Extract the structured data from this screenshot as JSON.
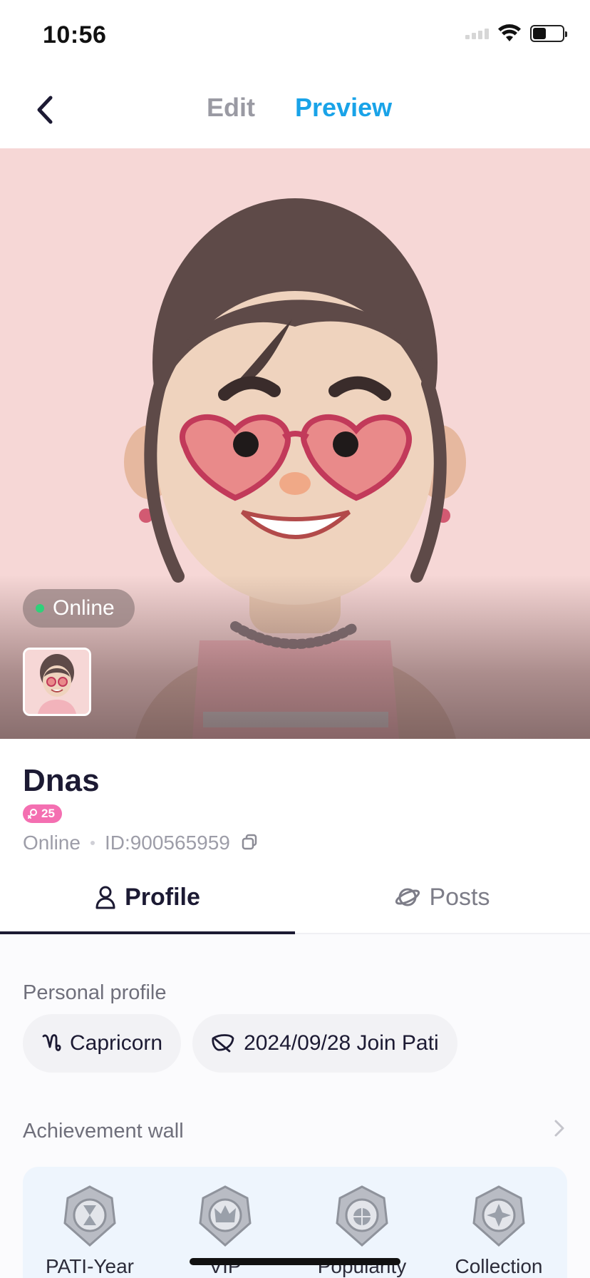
{
  "status_bar": {
    "time": "10:56",
    "icons": [
      "signal-icon",
      "wifi-icon",
      "battery-icon"
    ]
  },
  "nav": {
    "edit_label": "Edit",
    "preview_label": "Preview",
    "active_tab": "Preview"
  },
  "hero": {
    "status_label": "Online"
  },
  "user": {
    "name": "Dnas",
    "level": "25",
    "status": "Online",
    "id_text": "ID:900565959"
  },
  "tabs": [
    {
      "label": "Profile",
      "icon": "person-icon",
      "active": true
    },
    {
      "label": "Posts",
      "icon": "planet-icon",
      "active": false
    }
  ],
  "profile": {
    "personal_title": "Personal profile",
    "chips": [
      {
        "icon": "capricorn-icon",
        "label": "Capricorn"
      },
      {
        "icon": "leaf-icon",
        "label": "2024/09/28 Join Pati"
      }
    ],
    "achievement_title": "Achievement wall",
    "achievements": [
      {
        "label": "PATI-Year"
      },
      {
        "label": "VIP"
      },
      {
        "label": "Popularity"
      },
      {
        "label": "Collection"
      }
    ]
  },
  "colors": {
    "accent": "#19a3e8",
    "text_dark": "#1c1a33",
    "level_badge": "#f46fb1",
    "online_dot": "#2fd17a",
    "hero_bg": "#f6d7d6"
  }
}
